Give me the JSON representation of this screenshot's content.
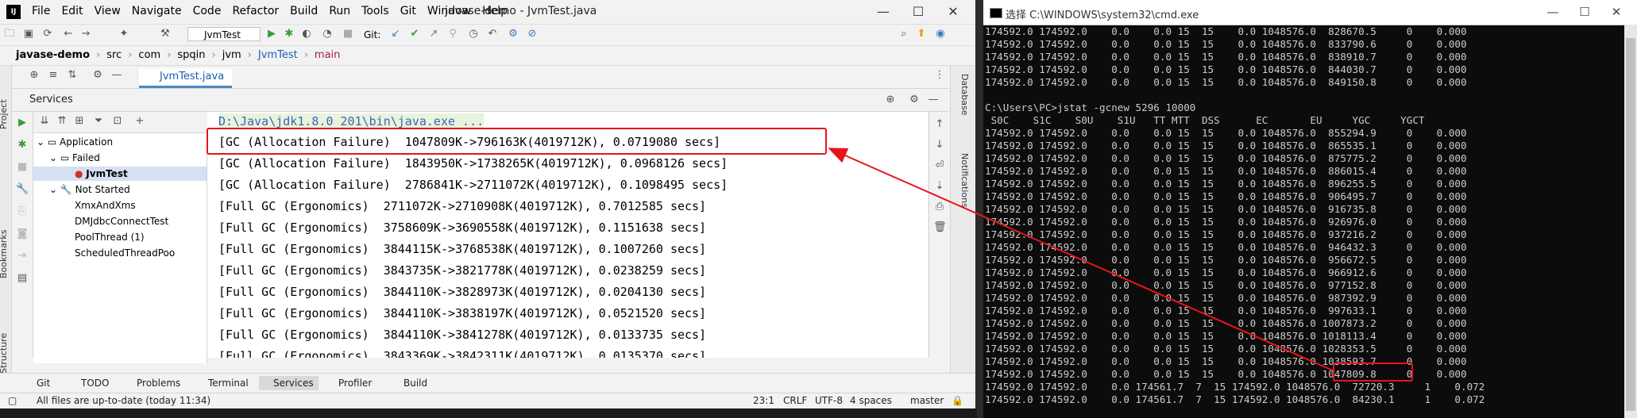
{
  "ide": {
    "window_title": "javase-demo - JvmTest.java",
    "menu": [
      "File",
      "Edit",
      "View",
      "Navigate",
      "Code",
      "Refactor",
      "Build",
      "Run",
      "Tools",
      "Git",
      "Window",
      "Help"
    ],
    "run_config": "JvmTest",
    "git_label": "Git:",
    "breadcrumb": [
      "javase-demo",
      "src",
      "com",
      "spqin",
      "jvm",
      "JvmTest",
      "main"
    ],
    "editor_tab": "JvmTest.java",
    "left_strip": [
      "Project",
      "Bookmarks",
      "Structure"
    ],
    "right_strip": [
      "Database",
      "Notifications"
    ],
    "services": {
      "title": "Services",
      "tree": [
        {
          "label": "Application",
          "level": 1
        },
        {
          "label": "Failed",
          "level": 2
        },
        {
          "label": "JvmTest",
          "level": 3
        },
        {
          "label": "Not Started",
          "level": 2
        },
        {
          "label": "XmxAndXms",
          "level": 3
        },
        {
          "label": "DMJdbcConnectTest",
          "level": 3
        },
        {
          "label": "PoolThread (1)",
          "level": 3
        },
        {
          "label": "ScheduledThreadPoo",
          "level": 3
        }
      ]
    },
    "console": [
      "D:\\Java\\jdk1.8.0_201\\bin\\java.exe ...",
      "[GC (Allocation Failure)  1047809K->796163K(4019712K), 0.0719080 secs]",
      "[GC (Allocation Failure)  1843950K->1738265K(4019712K), 0.0968126 secs]",
      "[GC (Allocation Failure)  2786841K->2711072K(4019712K), 0.1098495 secs]",
      "[Full GC (Ergonomics)  2711072K->2710908K(4019712K), 0.7012585 secs]",
      "[Full GC (Ergonomics)  3758609K->3690558K(4019712K), 0.1151638 secs]",
      "[Full GC (Ergonomics)  3844115K->3768538K(4019712K), 0.1007260 secs]",
      "[Full GC (Ergonomics)  3843735K->3821778K(4019712K), 0.0238259 secs]",
      "[Full GC (Ergonomics)  3844110K->3828973K(4019712K), 0.0204130 secs]",
      "[Full GC (Ergonomics)  3844110K->3838197K(4019712K), 0.0521520 secs]",
      "[Full GC (Ergonomics)  3844110K->3841278K(4019712K), 0.0133735 secs]",
      "[Full GC (Ergonomics)  3843369K->3842311K(4019712K), 0.0135370 secs]"
    ],
    "bottom_tabs": [
      "Git",
      "TODO",
      "Problems",
      "Terminal",
      "Services",
      "Profiler",
      "Build"
    ],
    "active_bottom_tab": "Services",
    "status": {
      "message": "All files are up-to-date (today 11:34)",
      "position": "23:1",
      "line_sep": "CRLF",
      "encoding": "UTF-8",
      "indent": "4 spaces",
      "branch": "master"
    }
  },
  "cmd": {
    "title": "选择 C:\\WINDOWS\\system32\\cmd.exe",
    "top_rows": [
      "174592.0 174592.0    0.0    0.0 15  15    0.0 1048576.0  828670.5     0    0.000",
      "174592.0 174592.0    0.0    0.0 15  15    0.0 1048576.0  833790.6     0    0.000",
      "174592.0 174592.0    0.0    0.0 15  15    0.0 1048576.0  838910.7     0    0.000",
      "174592.0 174592.0    0.0    0.0 15  15    0.0 1048576.0  844030.7     0    0.000",
      "174592.0 174592.0    0.0    0.0 15  15    0.0 1048576.0  849150.8     0    0.000"
    ],
    "command": "C:\\Users\\PC>jstat -gcnew 5296 10000",
    "header": " S0C    S1C    S0U    S1U   TT MTT  DSS      EC       EU     YGC     YGCT",
    "rows": [
      "174592.0 174592.0    0.0    0.0 15  15    0.0 1048576.0  855294.9     0    0.000",
      "174592.0 174592.0    0.0    0.0 15  15    0.0 1048576.0  865535.1     0    0.000",
      "174592.0 174592.0    0.0    0.0 15  15    0.0 1048576.0  875775.2     0    0.000",
      "174592.0 174592.0    0.0    0.0 15  15    0.0 1048576.0  886015.4     0    0.000",
      "174592.0 174592.0    0.0    0.0 15  15    0.0 1048576.0  896255.5     0    0.000",
      "174592.0 174592.0    0.0    0.0 15  15    0.0 1048576.0  906495.7     0    0.000",
      "174592.0 174592.0    0.0    0.0 15  15    0.0 1048576.0  916735.8     0    0.000",
      "174592.0 174592.0    0.0    0.0 15  15    0.0 1048576.0  926976.0     0    0.000",
      "174592.0 174592.0    0.0    0.0 15  15    0.0 1048576.0  937216.2     0    0.000",
      "174592.0 174592.0    0.0    0.0 15  15    0.0 1048576.0  946432.3     0    0.000",
      "174592.0 174592.0    0.0    0.0 15  15    0.0 1048576.0  956672.5     0    0.000",
      "174592.0 174592.0    0.0    0.0 15  15    0.0 1048576.0  966912.6     0    0.000",
      "174592.0 174592.0    0.0    0.0 15  15    0.0 1048576.0  977152.8     0    0.000",
      "174592.0 174592.0    0.0    0.0 15  15    0.0 1048576.0  987392.9     0    0.000",
      "174592.0 174592.0    0.0    0.0 15  15    0.0 1048576.0  997633.1     0    0.000",
      "174592.0 174592.0    0.0    0.0 15  15    0.0 1048576.0 1007873.2     0    0.000",
      "174592.0 174592.0    0.0    0.0 15  15    0.0 1048576.0 1018113.4     0    0.000",
      "174592.0 174592.0    0.0    0.0 15  15    0.0 1048576.0 1028353.5     0    0.000",
      "174592.0 174592.0    0.0    0.0 15  15    0.0 1048576.0 1038593.7     0    0.000",
      "174592.0 174592.0    0.0    0.0 15  15    0.0 1048576.0 1047809.8     0    0.000",
      "174592.0 174592.0    0.0 174561.7  7  15 174592.0 1048576.0  72720.3     1    0.072",
      "174592.0 174592.0    0.0 174561.7  7  15 174592.0 1048576.0  84230.1     1    0.072"
    ]
  },
  "colors": {
    "annotation": "#e8141c",
    "console_bg": "#0c0c0c",
    "ide_bg": "#f2f2f2"
  }
}
